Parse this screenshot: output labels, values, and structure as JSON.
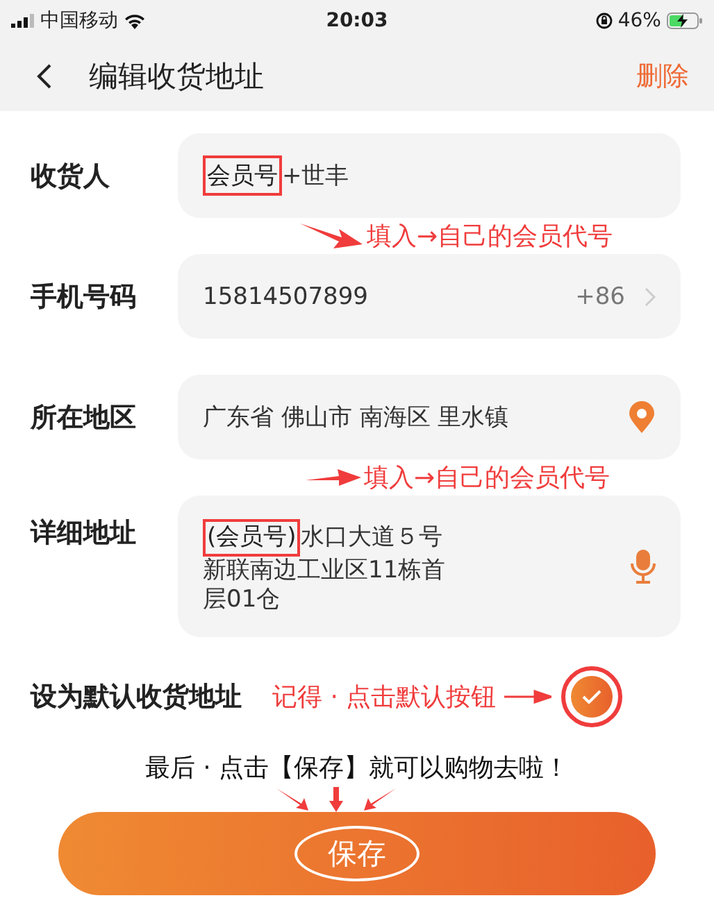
{
  "status_bar": {
    "carrier": "中国移动",
    "time": "20:03",
    "battery": "46%"
  },
  "nav": {
    "title": "编辑收货地址",
    "action": "删除"
  },
  "fields": [
    {
      "kind": "text",
      "label": "收货人",
      "highlight": "会员号",
      "value": "+世丰",
      "note": "填入→自己的会员代号"
    },
    {
      "kind": "phone",
      "label": "手机号码",
      "value": "15814507899",
      "prefix": "+86"
    },
    {
      "kind": "region",
      "label": "所在地区",
      "value": "广东省 佛山市 南海区 里水镇",
      "note": "填入→自己的会员代号"
    },
    {
      "kind": "address",
      "label": "详细地址",
      "highlight": "(会员号)",
      "lines": [
        "水口大道５号",
        "新联南边工业区11栋首",
        "层01仓"
      ]
    }
  ],
  "default": {
    "label": "设为默认收货地址",
    "checked": true,
    "note": "记得 · 点击默认按钮"
  },
  "instruction": "最后 · 点击【保存】就可以购物去啦！",
  "save_button": "保存"
}
